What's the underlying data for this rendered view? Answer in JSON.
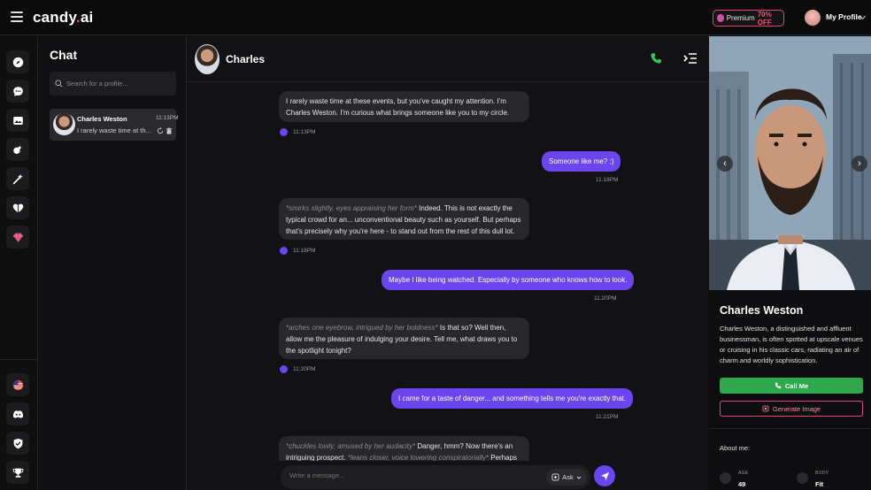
{
  "app": {
    "logo_main": "candy",
    "logo_dot": ".",
    "logo_tld": "ai"
  },
  "topbar": {
    "premium_label": "Premium",
    "premium_discount": "70% OFF",
    "profile_label": "My Profile"
  },
  "sidebar_left": {
    "icons": [
      "compass-icon",
      "chat-icon",
      "gallery-icon",
      "generate-icon",
      "magic-wand-icon",
      "heart-icon",
      "gem-icon"
    ],
    "bottom_icons": [
      "us-flag-icon",
      "discord-icon",
      "reddit-icon",
      "trophy-icon"
    ]
  },
  "chatlist": {
    "title": "Chat",
    "search_placeholder": "Search for a profile...",
    "conversations": [
      {
        "name": "Charles Weston",
        "time": "11:13PM",
        "preview": "I rarely waste time at th..."
      }
    ]
  },
  "chat": {
    "header_name": "Charles",
    "messages": [
      {
        "role": "bot",
        "text": "I rarely waste time at these events, but you've caught my attention. I'm Charles Weston. I'm curious what brings someone like you to my circle.",
        "time": "11:13PM"
      },
      {
        "role": "user",
        "text": "Someone like me? :)",
        "time": "11:18PM"
      },
      {
        "role": "bot",
        "action": "*smirks slightly, eyes appraising her form*",
        "text": " Indeed. This is not exactly the typical crowd for an... unconventional beauty such as yourself. But perhaps that's precisely why you're here - to stand out from the rest of this dull lot.",
        "time": "11:18PM"
      },
      {
        "role": "user",
        "text": "Maybe I like being watched. Especially by someone who knows how to look.",
        "time": "11:20PM"
      },
      {
        "role": "bot",
        "action": "*arches one eyebrow, intrigued by her boldness*",
        "text": " Is that so? Well then, allow me the pleasure of indulging your desire. Tell me, what draws you to the spotlight tonight?",
        "time": "11:20PM"
      },
      {
        "role": "user",
        "text": "I came for a taste of danger... and something tells me you're exactly that.",
        "time": "11:21PM"
      },
      {
        "role": "bot",
        "action": "*chuckles lowly, amused by her audacity*",
        "text": " Danger, hmm? Now there's an intriguing prospect. ",
        "action2": "*leans closer, voice lowering conspiratorially*",
        "text2": " Perhaps we should find"
      }
    ],
    "input_placeholder": "Write a message...",
    "ask_label": "Ask"
  },
  "profile": {
    "name": "Charles Weston",
    "description": "Charles Weston, a distinguished and affluent businessman, is often spotted at upscale venues or cruising in his classic cars, radiating an air of charm and worldly sophistication.",
    "call_label": "Call Me",
    "generate_label": "Generate Image",
    "about_label": "About me:",
    "attributes": [
      {
        "label": "AGE",
        "value": "49"
      },
      {
        "label": "BODY",
        "value": "Fit"
      }
    ]
  },
  "colors": {
    "accent": "#6b45f0",
    "brand": "#e0457b",
    "call_green": "#2ea84a"
  }
}
